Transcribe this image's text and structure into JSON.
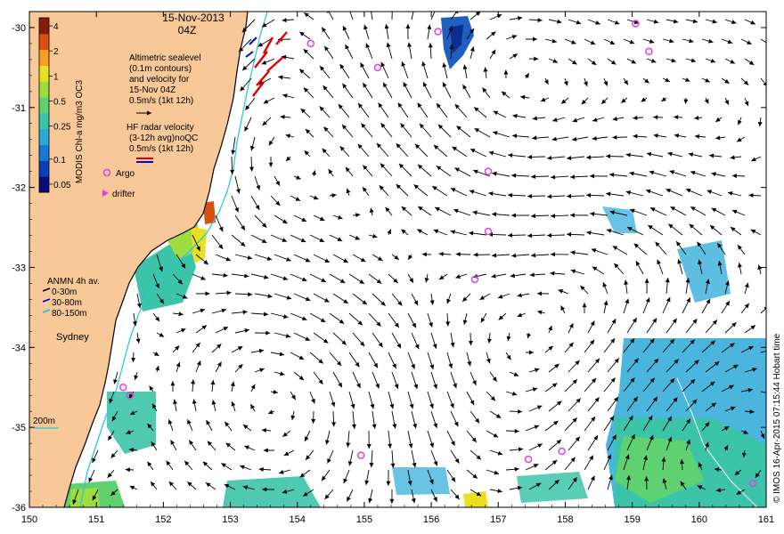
{
  "title": {
    "date": "15-Nov-2013",
    "time": "04Z"
  },
  "x_axis": {
    "ticks": [
      "150",
      "151",
      "152",
      "153",
      "154",
      "155",
      "156",
      "157",
      "158",
      "159",
      "160",
      "161"
    ],
    "min": 150,
    "max": 161
  },
  "y_axis": {
    "ticks": [
      "-30",
      "-31",
      "-32",
      "-33",
      "-34",
      "-35",
      "-36"
    ],
    "min": -36,
    "max": -29.8
  },
  "colorbar": {
    "label": "MODIS Chl-a mg/m3 OC3",
    "ticks": [
      "4",
      "2",
      "1",
      "0.5",
      "0.25",
      "0.1",
      "0.05"
    ],
    "scale": "log",
    "colors": [
      "#0a0a7a",
      "#0b3fb8",
      "#1679d8",
      "#2aa9d8",
      "#3cc4a8",
      "#5fd170",
      "#9fdc40",
      "#e8e020",
      "#f5a020",
      "#d85010",
      "#8a1a08"
    ]
  },
  "legend": {
    "altimetry": [
      "Altimetric sealevel",
      "(0.1m contours)",
      "and velocity for",
      "15-Nov 04Z",
      "0.5m/s (1kt 12h)"
    ],
    "hf_radar": [
      "HF radar velocity",
      "(3-12h avg)noQC",
      "0.5m/s (1kt 12h)"
    ],
    "argo": "Argo",
    "drifter": "drifter",
    "anmn_title": "ANMN 4h av.",
    "anmn_items": [
      {
        "label": "0-30m",
        "color": "#000000"
      },
      {
        "label": "30-80m",
        "color": "#0000cc"
      },
      {
        "label": "80-150m",
        "color": "#00cccc"
      }
    ],
    "isobath": "200m"
  },
  "place_label": "Sydney",
  "credit": "© IMOS 16-Apr-2015 07:15:44 Hobart time",
  "colors": {
    "land": "#f8c898",
    "argo": "#e040e0",
    "radar_red": "#e00000",
    "radar_blue": "#0000e0",
    "isobath": "#30c8d8"
  },
  "argo_floats": [
    {
      "lon": 154.2,
      "lat": -30.2
    },
    {
      "lon": 155.2,
      "lat": -30.5
    },
    {
      "lon": 156.1,
      "lat": -30.05
    },
    {
      "lon": 159.05,
      "lat": -29.95
    },
    {
      "lon": 159.25,
      "lat": -30.3
    },
    {
      "lon": 156.85,
      "lat": -31.8
    },
    {
      "lon": 156.85,
      "lat": -32.55
    },
    {
      "lon": 156.65,
      "lat": -33.15
    },
    {
      "lon": 151.4,
      "lat": -34.5
    },
    {
      "lon": 151.5,
      "lat": -34.6
    },
    {
      "lon": 154.95,
      "lat": -35.35
    },
    {
      "lon": 157.95,
      "lat": -35.3
    },
    {
      "lon": 157.45,
      "lat": -35.4
    },
    {
      "lon": 160.8,
      "lat": -35.7
    }
  ]
}
